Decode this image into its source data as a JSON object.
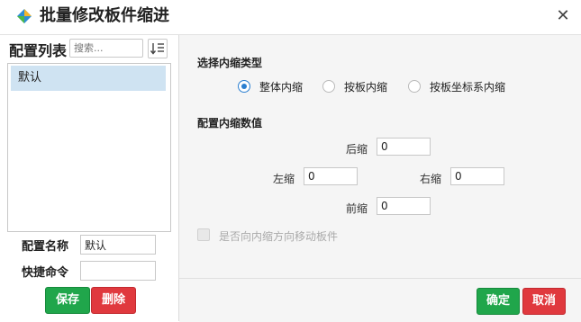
{
  "window": {
    "title": "批量修改板件缩进"
  },
  "left_panel": {
    "list_title": "配置列表",
    "search_placeholder": "搜索...",
    "items": [
      {
        "label": "默认"
      }
    ],
    "name_label": "配置名称",
    "name_value": "默认",
    "shortcut_label": "快捷命令",
    "shortcut_value": "",
    "save_label": "保存",
    "delete_label": "删除"
  },
  "right_panel": {
    "type_section": "选择内缩类型",
    "radios": [
      {
        "label": "整体内缩",
        "selected": true
      },
      {
        "label": "按板内缩",
        "selected": false
      },
      {
        "label": "按板坐标系内缩",
        "selected": false
      }
    ],
    "values_section": "配置内缩数值",
    "back_label": "后缩",
    "back_value": "0",
    "left_label": "左缩",
    "left_value": "0",
    "right_label": "右缩",
    "right_value": "0",
    "front_label": "前缩",
    "front_value": "0",
    "move_checkbox_label": "是否向内缩方向移动板件",
    "confirm_label": "确定",
    "cancel_label": "取消"
  },
  "colors": {
    "accent_green": "#20a64b",
    "accent_red": "#e0393e",
    "selection": "#cfe3f2",
    "radio_blue": "#2b7fd0"
  }
}
